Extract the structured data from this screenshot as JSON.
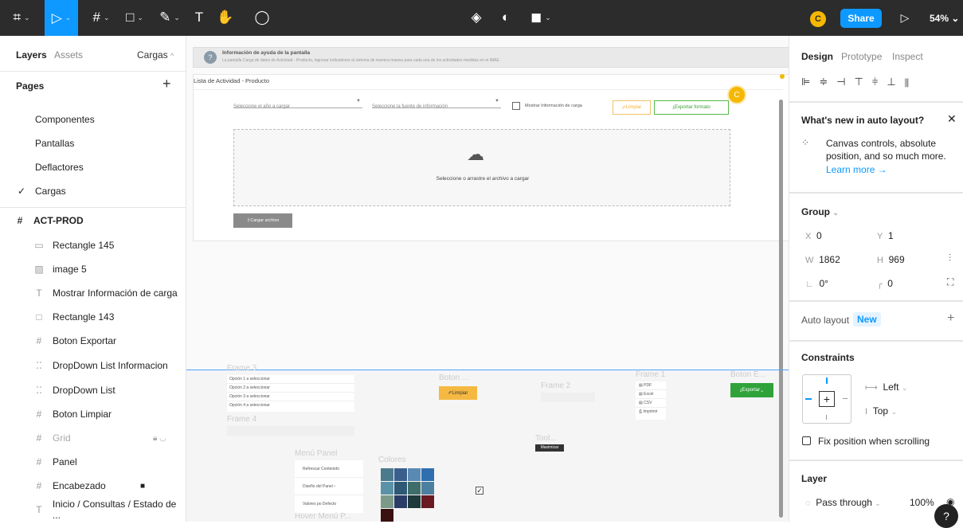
{
  "toolbar": {
    "main_menu_icon": "figma-logo-icon",
    "share_label": "Share",
    "avatar_letter": "C",
    "zoom": "54%",
    "text_tool": "T"
  },
  "left_panel": {
    "tab_layers": "Layers",
    "tab_assets": "Assets",
    "page_name": "Cargas",
    "pages_title": "Pages",
    "pages": [
      "Componentes",
      "Pantallas",
      "Deflactores",
      "Cargas"
    ],
    "frame_name": "ACT-PROD",
    "layers": [
      {
        "icon": "rect",
        "label": "Rectangle 145"
      },
      {
        "icon": "image",
        "label": "image 5"
      },
      {
        "icon": "text",
        "label": "Mostrar Información de carga"
      },
      {
        "icon": "rect",
        "label": "Rectangle 143"
      },
      {
        "icon": "frame",
        "label": "Boton Exportar"
      },
      {
        "icon": "component",
        "label": "DropDown List Informacion"
      },
      {
        "icon": "component",
        "label": "DropDown List"
      },
      {
        "icon": "frame",
        "label": "Boton Limpiar"
      },
      {
        "icon": "frame",
        "label": "Grid"
      },
      {
        "icon": "frame",
        "label": "Panel"
      },
      {
        "icon": "frame",
        "label": "Encabezado"
      },
      {
        "icon": "text",
        "label": "Inicio / Consultas / Estado de ..."
      }
    ]
  },
  "canvas": {
    "help_title": "Información de ayuda de la pantalla",
    "help_text": "La pantalla Carga de datos de Actividad - Producto, ingresar indicadores al sistema de manera masiva para cada una de los actividades medidas en el IMAE.",
    "card_title": "Lista de Actividad - Producto",
    "select_year": "Seleccione el año a cargar",
    "select_source": "Seleccione la fuente de información",
    "checkbox_label": "Mostrar Información de carga",
    "btn_clear": "Limpiar",
    "btn_export": "Exportar formato",
    "avatar_letter": "C",
    "dropzone_text": "Seleccione o arrastre el archivo a cargar",
    "upload_btn": "Cargar archivo",
    "frame3": "Frame 3",
    "frame3_options": [
      "Opción 1 a seleccionar",
      "Opción 2 a seleccionar",
      "Opción 3 a seleccionar",
      "Opción 4 a seleccionar"
    ],
    "frame4": "Frame 4",
    "boton_clear_title": "Boton ...",
    "boton_clear_label": "Limpiar",
    "frame2": "Frame 2",
    "frame1": "Frame 1",
    "frame1_items": [
      "PDF",
      "Excel",
      "CSV",
      "Imprimir"
    ],
    "boton_export_title": "Boton E...",
    "boton_export_label": "Exportar",
    "tool_title": "Tool...",
    "tool_label": "Maximizar",
    "menu_panel_title": "Menú Panel",
    "menu_items": [
      "Refrescar Contenido",
      "Diseño del Panel",
      "Valores po Defecto"
    ],
    "colores_title": "Colores",
    "hover_title": "Hover Menú P...",
    "swatches": [
      "#4a7a8c",
      "#3a5f8c",
      "#5a8ab4",
      "#2f6fb0",
      "#5a92a8",
      "#2e5874",
      "#3f6d6a",
      "#4d7fa0",
      "#7c9a8a",
      "#2b3c66",
      "#1f3a3a",
      "#6a1a22",
      "#3a1010"
    ]
  },
  "right_panel": {
    "tabs": [
      "Design",
      "Prototype",
      "Inspect"
    ],
    "whats_new_title": "What's new in auto layout?",
    "whats_new_text": "Canvas controls, absolute position, and so much more.",
    "learn_more": "Learn more →",
    "group_label": "Group",
    "x_label": "X",
    "x_val": "0",
    "y_label": "Y",
    "y_val": "1",
    "w_label": "W",
    "w_val": "1862",
    "h_label": "H",
    "h_val": "969",
    "rotation": "0°",
    "radius": "0",
    "auto_layout": "Auto layout",
    "new_badge": "New",
    "constraints": "Constraints",
    "constraint_h": "Left",
    "constraint_v": "Top",
    "fix_position": "Fix position when scrolling",
    "layer": "Layer",
    "blend": "Pass through",
    "opacity": "100%",
    "help": "?"
  }
}
